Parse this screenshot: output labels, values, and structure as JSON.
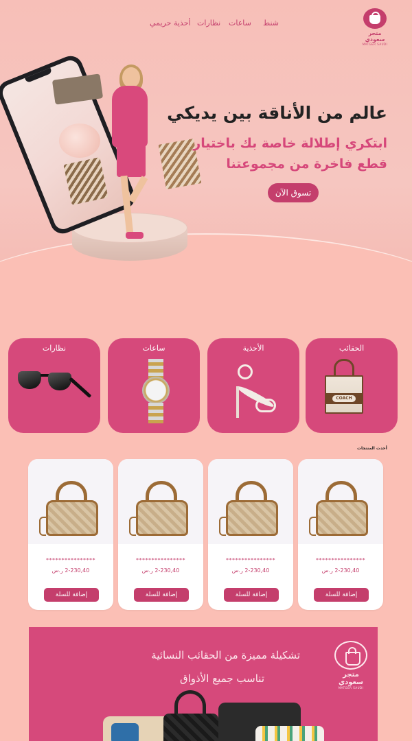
{
  "nav": {
    "items": [
      "شنط",
      "ساعات",
      "نظارات",
      "أحذية حريمي"
    ],
    "logo_text": "متجر سعودي",
    "logo_sub": "MATGER SAUDI"
  },
  "hero": {
    "title": "عالم من الأناقة بين يديكي",
    "subtitle_line1": "ابتكري إطلالة خاصة بك باختيار",
    "subtitle_line2": "قطع فاخرة من مجموعتنا",
    "cta": "تسوق الآن"
  },
  "categories": [
    {
      "label": "الحقائب",
      "icon": "tote-bag-image"
    },
    {
      "label": "الأحذية",
      "icon": "heel-shoe-image"
    },
    {
      "label": "ساعات",
      "icon": "watch-image"
    },
    {
      "label": "نظارات",
      "icon": "sunglasses-image"
    }
  ],
  "category_image_text": {
    "tote_label": "COACH"
  },
  "latest_label": "أحدث المنتجات",
  "products": [
    {
      "stars": "****************",
      "price": "2-230,40 ر.س",
      "button": "إضافة للسلة"
    },
    {
      "stars": "****************",
      "price": "2-230,40 ر.س",
      "button": "إضافة للسلة"
    },
    {
      "stars": "****************",
      "price": "2-230,40 ر.س",
      "button": "إضافة للسلة"
    },
    {
      "stars": "****************",
      "price": "2-230,40 ر.س",
      "button": "إضافة للسلة"
    }
  ],
  "promo": {
    "line1": "تشكيلة مميزة من الحقائب النسائية",
    "line2": "تناسب جميع الأذواق",
    "logo_text": "متجر سعودي",
    "logo_sub": "MATGER SAUDI"
  },
  "colors": {
    "accent": "#c43e6c",
    "card_pink": "#d6497b",
    "background": "#fbbfb5"
  }
}
